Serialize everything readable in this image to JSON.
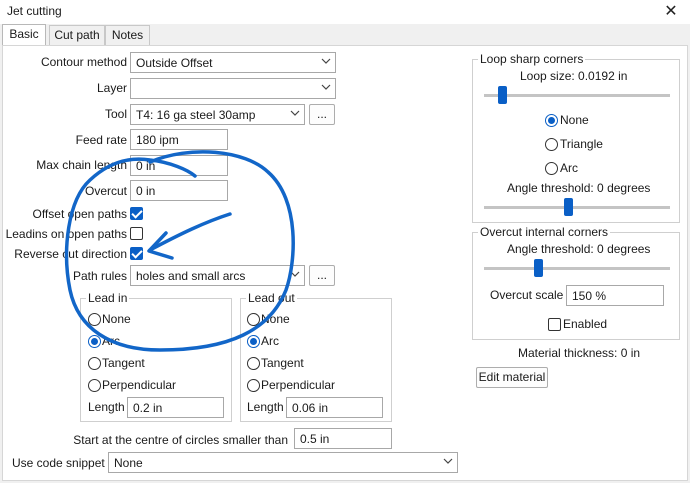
{
  "window": {
    "title": "Jet cutting"
  },
  "tabs": [
    {
      "label": "Basic"
    },
    {
      "label": "Cut path"
    },
    {
      "label": "Notes"
    }
  ],
  "basic": {
    "contour_method": {
      "label": "Contour method",
      "value": "Outside Offset"
    },
    "layer": {
      "label": "Layer",
      "value": ""
    },
    "tool": {
      "label": "Tool",
      "value": "T4: 16 ga steel  30amp",
      "browse": "..."
    },
    "feed_rate": {
      "label": "Feed rate",
      "value": "180 ipm"
    },
    "max_chain_length": {
      "label": "Max chain length",
      "value": "0 in"
    },
    "overcut": {
      "label": "Overcut",
      "value": "0 in"
    },
    "offset_open_paths": {
      "label": "Offset open paths",
      "checked": true
    },
    "leadins_on_open_paths": {
      "label": "Leadins on open paths",
      "checked": false
    },
    "reverse_cut_direction": {
      "label": "Reverse cut direction",
      "checked": true
    },
    "path_rules": {
      "label": "Path rules",
      "value": "holes and small arcs",
      "browse": "..."
    },
    "lead_in": {
      "title": "Lead in",
      "options": [
        "None",
        "Arc",
        "Tangent",
        "Perpendicular"
      ],
      "selected": "Arc",
      "length_label": "Length",
      "length_value": "0.2 in"
    },
    "lead_out": {
      "title": "Lead out",
      "options": [
        "None",
        "Arc",
        "Tangent",
        "Perpendicular"
      ],
      "selected": "Arc",
      "length_label": "Length",
      "length_value": "0.06 in"
    },
    "start_centre": {
      "label": "Start at the centre of circles smaller than",
      "value": "0.5 in"
    },
    "code_snippet": {
      "label": "Use code snippet",
      "value": "None"
    }
  },
  "loop_sharp_corners": {
    "title": "Loop sharp corners",
    "loop_size_label": "Loop size: 0.0192 in",
    "loop_size_slider": 0.08,
    "options": [
      "None",
      "Triangle",
      "Arc"
    ],
    "selected": "None",
    "angle_label": "Angle threshold: 0 degrees",
    "angle_slider": 0.45
  },
  "overcut_internal_corners": {
    "title": "Overcut internal corners",
    "angle_label": "Angle threshold: 0 degrees",
    "angle_slider": 0.28,
    "scale_label": "Overcut scale",
    "scale_value": "150 %",
    "enabled_label": "Enabled",
    "enabled": false
  },
  "material": {
    "thickness_label": "Material thickness: 0 in",
    "edit_label": "Edit material"
  },
  "colors": {
    "accent": "#0a5fc6",
    "ink": "#1266c8"
  }
}
